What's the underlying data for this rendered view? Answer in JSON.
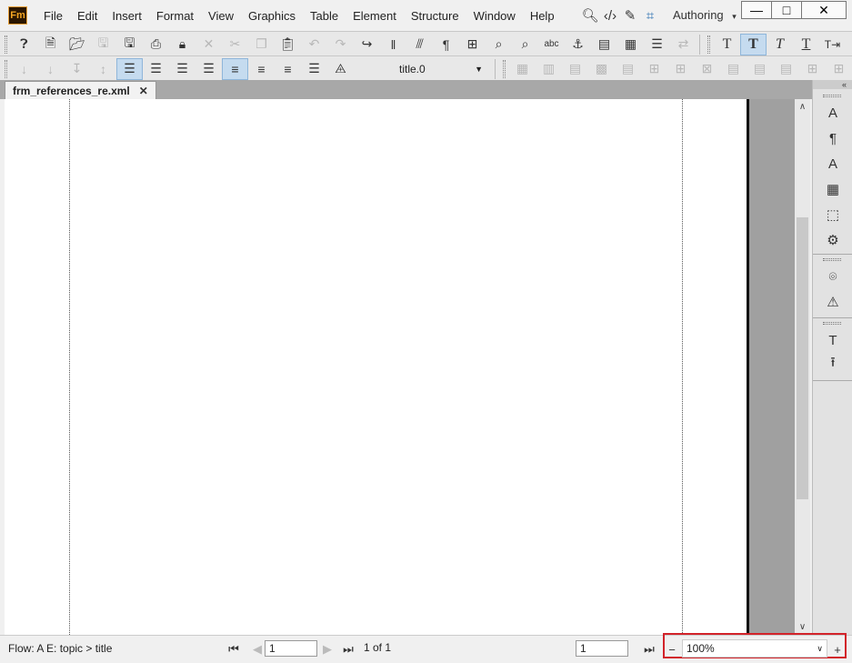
{
  "app": {
    "logo_text": "Fm"
  },
  "menu": [
    "File",
    "Edit",
    "Insert",
    "Format",
    "View",
    "Graphics",
    "Table",
    "Element",
    "Structure",
    "Window",
    "Help"
  ],
  "title_icons": [
    "search-icon",
    "code-view-icon",
    "pencil-icon",
    "crop-frame-icon"
  ],
  "workspace": "Authoring",
  "window_buttons": {
    "minimize": "—",
    "maximize": "□",
    "close": "✕"
  },
  "toolbar_main": {
    "buttons": [
      "help-icon",
      "new-document-icon",
      "open-folder-icon",
      "save-icon",
      "save-as-icon",
      "print-icon",
      "lock-icon",
      "delete-icon",
      "cut-icon",
      "copy-icon",
      "paste-icon",
      "undo-icon",
      "redo-icon",
      "go-to-icon",
      "element-bracket-icon",
      "insert-char-tag-icon",
      "insert-para-tag-icon",
      "insert-table-tag-icon",
      "find-icon",
      "find-replace-icon",
      "spell-check-icon",
      "anchored-frame-icon",
      "reference-page-icon",
      "table-icon",
      "variable-icon",
      "cross-ref-icon"
    ],
    "text_styles": [
      "T",
      "T",
      "T",
      "T"
    ],
    "text_style_names": [
      "plain-text-icon",
      "bold-text-icon",
      "italic-text-icon",
      "underline-text-icon"
    ]
  },
  "toolbar_format": {
    "paragraph_tag": "title.0"
  },
  "document": {
    "tab_title": "frm_references_re.xml"
  },
  "status": {
    "flow": "Flow: A  E: topic > title",
    "page_input": "1",
    "page_of": "1 of 1",
    "goto_input": "1",
    "zoom": "100%"
  }
}
